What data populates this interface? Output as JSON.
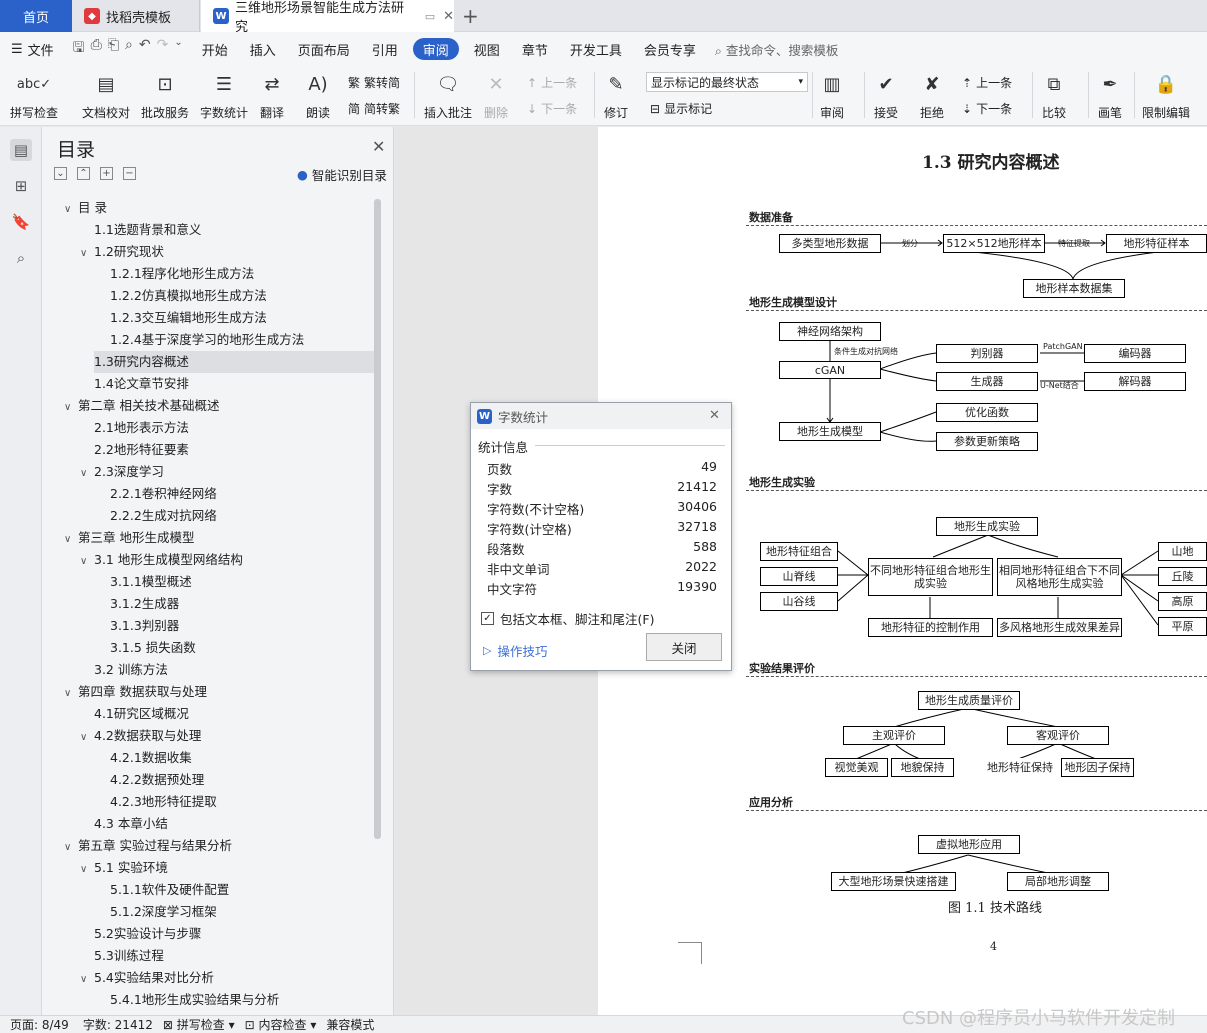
{
  "tabs": {
    "home": "首页",
    "template": "找稻壳模板",
    "document": "三维地形场景智能生成方法研究"
  },
  "menu": {
    "file": "文件",
    "items": [
      "开始",
      "插入",
      "页面布局",
      "引用",
      "审阅",
      "视图",
      "章节",
      "开发工具",
      "会员专享"
    ],
    "active": "审阅",
    "search": "查找命令、搜索模板"
  },
  "ribbon": {
    "spell": "拼写检查",
    "proof": "文档校对",
    "batch": "批改服务",
    "wordcount": "字数统计",
    "translate": "翻译",
    "read": "朗读",
    "to_trad": "繁转简",
    "to_simp": "简转繁",
    "insert_comment": "插入批注",
    "delete": "删除",
    "prev": "上一条",
    "next": "下一条",
    "revise": "修订",
    "markup_state": "显示标记的最终状态",
    "show_markup": "显示标记",
    "review": "审阅",
    "accept": "接受",
    "reject": "拒绝",
    "prev2": "上一条",
    "next2": "下一条",
    "compare": "比较",
    "pen": "画笔",
    "restrict": "限制编辑"
  },
  "toc": {
    "title": "目录",
    "smart": "智能识别目录",
    "items": [
      {
        "t": "目 录",
        "lvl": 1,
        "caret": "v"
      },
      {
        "t": "1.1选题背景和意义",
        "lvl": 2,
        "caret": ""
      },
      {
        "t": "1.2研究现状",
        "lvl": 2,
        "caret": "v"
      },
      {
        "t": "1.2.1程序化地形生成方法",
        "lvl": 3,
        "caret": ""
      },
      {
        "t": "1.2.2仿真模拟地形生成方法",
        "lvl": 3,
        "caret": ""
      },
      {
        "t": "1.2.3交互编辑地形生成方法",
        "lvl": 3,
        "caret": ""
      },
      {
        "t": "1.2.4基于深度学习的地形生成方法",
        "lvl": 3,
        "caret": ""
      },
      {
        "t": "1.3研究内容概述",
        "lvl": 2,
        "caret": "",
        "sel": true
      },
      {
        "t": "1.4论文章节安排",
        "lvl": 2,
        "caret": ""
      },
      {
        "t": "第二章 相关技术基础概述",
        "lvl": 1,
        "caret": "v"
      },
      {
        "t": "2.1地形表示方法",
        "lvl": 2,
        "caret": ""
      },
      {
        "t": "2.2地形特征要素",
        "lvl": 2,
        "caret": ""
      },
      {
        "t": "2.3深度学习",
        "lvl": 2,
        "caret": "v"
      },
      {
        "t": "2.2.1卷积神经网络",
        "lvl": 3,
        "caret": ""
      },
      {
        "t": "2.2.2生成对抗网络",
        "lvl": 3,
        "caret": ""
      },
      {
        "t": "第三章 地形生成模型",
        "lvl": 1,
        "caret": "v"
      },
      {
        "t": "3.1 地形生成模型网络结构",
        "lvl": 2,
        "caret": "v"
      },
      {
        "t": "3.1.1模型概述",
        "lvl": 3,
        "caret": ""
      },
      {
        "t": "3.1.2生成器",
        "lvl": 3,
        "caret": ""
      },
      {
        "t": "3.1.3判别器",
        "lvl": 3,
        "caret": ""
      },
      {
        "t": "3.1.5 损失函数",
        "lvl": 3,
        "caret": ""
      },
      {
        "t": "3.2 训练方法",
        "lvl": 2,
        "caret": ""
      },
      {
        "t": "第四章 数据获取与处理",
        "lvl": 1,
        "caret": "v"
      },
      {
        "t": "4.1研究区域概况",
        "lvl": 2,
        "caret": ""
      },
      {
        "t": "4.2数据获取与处理",
        "lvl": 2,
        "caret": "v"
      },
      {
        "t": "4.2.1数据收集",
        "lvl": 3,
        "caret": ""
      },
      {
        "t": "4.2.2数据预处理",
        "lvl": 3,
        "caret": ""
      },
      {
        "t": "4.2.3地形特征提取",
        "lvl": 3,
        "caret": ""
      },
      {
        "t": "4.3 本章小结",
        "lvl": 2,
        "caret": ""
      },
      {
        "t": "第五章 实验过程与结果分析",
        "lvl": 1,
        "caret": "v"
      },
      {
        "t": "5.1 实验环境",
        "lvl": 2,
        "caret": "v"
      },
      {
        "t": "5.1.1软件及硬件配置",
        "lvl": 3,
        "caret": ""
      },
      {
        "t": "5.1.2深度学习框架",
        "lvl": 3,
        "caret": ""
      },
      {
        "t": "5.2实验设计与步骤",
        "lvl": 2,
        "caret": ""
      },
      {
        "t": "5.3训练过程",
        "lvl": 2,
        "caret": ""
      },
      {
        "t": "5.4实验结果对比分析",
        "lvl": 2,
        "caret": "v"
      },
      {
        "t": "5.4.1地形生成实验结果与分析",
        "lvl": 3,
        "caret": ""
      }
    ]
  },
  "dialog": {
    "title": "字数统计",
    "section": "统计信息",
    "rows": [
      {
        "k": "页数",
        "v": "49"
      },
      {
        "k": "字数",
        "v": "21412"
      },
      {
        "k": "字符数(不计空格)",
        "v": "30406"
      },
      {
        "k": "字符数(计空格)",
        "v": "32718"
      },
      {
        "k": "段落数",
        "v": "588"
      },
      {
        "k": "非中文单词",
        "v": "2022"
      },
      {
        "k": "中文字符",
        "v": "19390"
      }
    ],
    "checkbox": "包括文本框、脚注和尾注(F)",
    "tips": "操作技巧",
    "close": "关闭"
  },
  "doc": {
    "heading": "1.3  研究内容概述",
    "sec1": "数据准备",
    "sec2": "地形生成模型设计",
    "sec3": "地形生成实验",
    "sec4": "实验结果评价",
    "sec5": "应用分析",
    "b_multi": "多类型地形数据",
    "b_512": "512×512地形样本",
    "b_feat": "地形特征样本",
    "b_set": "地形样本数据集",
    "l_div": "划分",
    "l_ext": "特征提取",
    "b_nn": "神经网络架构",
    "l_cond": "条件生成对抗网络",
    "b_cgan": "cGAN",
    "b_disc": "判别器",
    "b_gen": "生成器",
    "l_patch": "PatchGAN",
    "l_unet": "U-Net结合",
    "b_enc": "编码器",
    "b_dec": "解码器",
    "b_opt": "优化函数",
    "b_param": "参数更新策略",
    "b_model": "地形生成模型",
    "b_exp": "地形生成实验",
    "b_combo": "地形特征组合",
    "b_ridge": "山脊线",
    "b_valley": "山谷线",
    "b_diff": "不同地形特征组合地形生成实验",
    "b_same": "相同地形特征组合下不同风格地形生成实验",
    "b_mtn": "山地",
    "b_hill": "丘陵",
    "b_plat": "高原",
    "b_plain": "平原",
    "b_ctrl": "地形特征的控制作用",
    "b_style": "多风格地形生成效果差异",
    "b_eval": "地形生成质量评价",
    "b_subj": "主观评价",
    "b_obj": "客观评价",
    "b_vis": "视觉美观",
    "b_geo": "地貌保持",
    "b_fk": "地形特征保持",
    "b_fac": "地形因子保持",
    "b_vr": "虚拟地形应用",
    "b_fast": "大型地形场景快速搭建",
    "b_local": "局部地形调整",
    "caption": "图 1.1 技术路线",
    "pagenum": "4"
  },
  "status": {
    "page": "页面: 8/49",
    "words": "字数: 21412",
    "spell": "拼写检查",
    "content": "内容检查",
    "compat": "兼容模式"
  },
  "watermark": "CSDN @程序员小马软件开发定制"
}
